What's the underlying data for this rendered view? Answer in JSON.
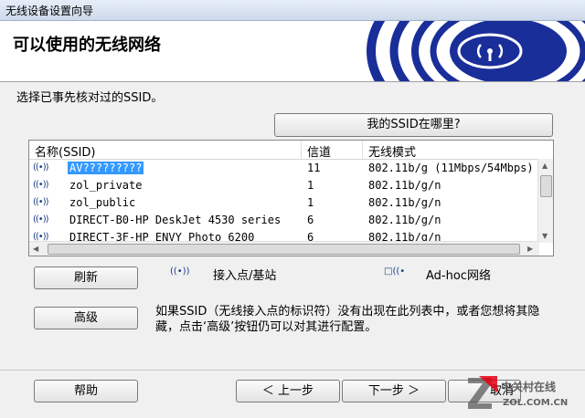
{
  "window": {
    "title": "无线设备设置向导"
  },
  "header": {
    "title": "可以使用的无线网络"
  },
  "instruction": "选择已事先核对过的SSID。",
  "buttons": {
    "where_ssid": "我的SSID在哪里?",
    "refresh": "刷新",
    "advanced": "高级",
    "help": "帮助",
    "back": "＜ 上一步",
    "next": "下一步 ＞",
    "cancel": "取消"
  },
  "table": {
    "columns": [
      "名称(SSID)",
      "信道",
      "无线模式"
    ],
    "rows": [
      {
        "icon": "access-point-icon",
        "ssid": "AV?????????",
        "channel": "11",
        "mode": "802.11b/g (11Mbps/54Mbps)",
        "selected": true
      },
      {
        "icon": "access-point-icon",
        "ssid": "zol_private",
        "channel": "1",
        "mode": "802.11b/g/n",
        "selected": false
      },
      {
        "icon": "access-point-icon",
        "ssid": "zol_public",
        "channel": "1",
        "mode": "802.11b/g/n",
        "selected": false
      },
      {
        "icon": "access-point-icon",
        "ssid": "DIRECT-B0-HP DeskJet 4530 series",
        "channel": "6",
        "mode": "802.11b/g/n",
        "selected": false
      },
      {
        "icon": "access-point-icon",
        "ssid": "DIRECT-3F-HP ENVY Photo 6200",
        "channel": "6",
        "mode": "802.11b/g/n",
        "selected": false
      }
    ]
  },
  "legend": {
    "ap_glyph": "((•))",
    "ap_label": "接入点/基站",
    "adhoc_glyph": "□((•",
    "adhoc_label": "Ad-hoc网络"
  },
  "note": "如果SSID（无线接入点的标识符）没有出现在此列表中，或者您想将其隐藏，点击‘高级’按钮仍可以对其进行配置。",
  "watermark": {
    "brand": "中关村在线",
    "url": "ZOL.COM.CN",
    "mark": "Z"
  },
  "colors": {
    "selection": "#3399ff",
    "logo_blue": "#1a2e9a"
  }
}
